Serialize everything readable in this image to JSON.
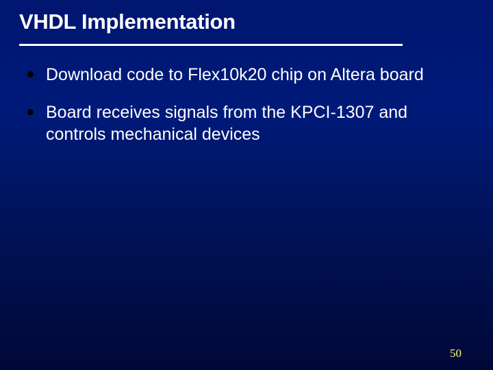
{
  "slide": {
    "title": "VHDL Implementation",
    "bullets": [
      "Download code to Flex10k20 chip on Altera board",
      "Board receives signals from the KPCI-1307 and controls mechanical devices"
    ],
    "page_number": "50"
  }
}
